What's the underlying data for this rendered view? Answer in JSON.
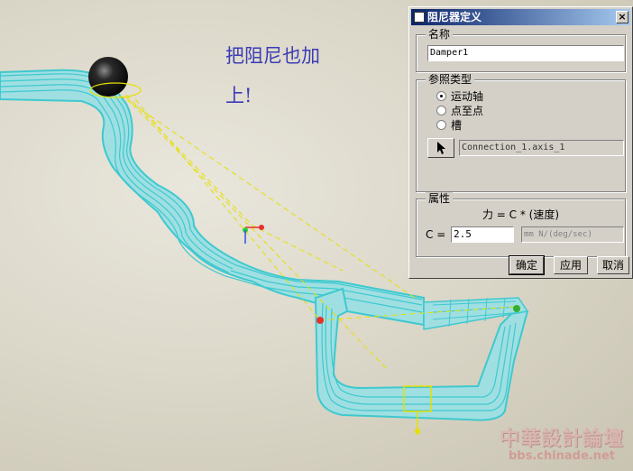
{
  "viewport": {
    "annotation_line1": "把阻尼也加",
    "annotation_line2": "上!",
    "watermark_title": "中華設計論壇",
    "watermark_url": "bbs.chinade.net"
  },
  "dialog": {
    "title": "阻尼器定义",
    "close_label": "×",
    "name_group": {
      "legend": "名称",
      "value": "Damper1"
    },
    "reference_group": {
      "legend": "参照类型",
      "options": [
        "运动轴",
        "点至点",
        "槽"
      ],
      "selected_index": 0,
      "reference_value": "Connection_1.axis_1"
    },
    "properties_group": {
      "legend": "属性",
      "formula": "力 = C * (速度)",
      "c_label": "C =",
      "c_value": "2.5",
      "unit": "mm N/(deg/sec)"
    },
    "buttons": {
      "ok": "确定",
      "apply": "应用",
      "cancel": "取消"
    }
  },
  "colors": {
    "model_cyan": "#3ec9cf",
    "ball": "#1a1a1a",
    "annotation": "#3c3cb4",
    "titlebar": "#0a246a"
  }
}
